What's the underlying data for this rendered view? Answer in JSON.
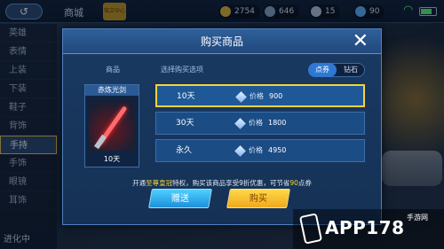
{
  "topbar": {
    "back_label": "↺",
    "title": "商城",
    "badge": "铭文中心",
    "currencies": [
      {
        "name": "gold",
        "value": "2754",
        "color": "#e4b63a"
      },
      {
        "name": "coupon",
        "value": "646",
        "color": "#8aa7c9"
      },
      {
        "name": "gem",
        "value": "15",
        "color": "#b9c9de"
      },
      {
        "name": "diamond",
        "value": "90",
        "color": "#5fb4ff"
      }
    ]
  },
  "sidebar": {
    "items": [
      "英雄",
      "表情",
      "上装",
      "下装",
      "鞋子",
      "背饰",
      "手持",
      "手饰",
      "眼镜",
      "耳饰"
    ],
    "active_index": 6,
    "footer": "进化中"
  },
  "dialog": {
    "title": "购买商品",
    "close_icon": "close-icon",
    "col_item": "商品",
    "col_options": "选择购买选项",
    "tabs": [
      "点券",
      "钻石"
    ],
    "active_tab": 0,
    "item": {
      "name": "赤炼光剑",
      "duration": "10天"
    },
    "options": [
      {
        "label": "10天",
        "price_label": "价格",
        "price": "900",
        "selected": true
      },
      {
        "label": "30天",
        "price_label": "价格",
        "price": "1800",
        "selected": false
      },
      {
        "label": "永久",
        "price_label": "价格",
        "price": "4950",
        "selected": false
      }
    ],
    "notice": {
      "prefix": "开通",
      "highlight": "至尊皇冠",
      "middle": "特权，购买该商品享受9折优惠，可节省",
      "amount": "90",
      "suffix": "点券"
    },
    "gift_button": "赠送",
    "buy_button": "购买"
  },
  "watermark": {
    "text": "APP178",
    "sub": "手游网"
  },
  "colors": {
    "accent": "#f5d33a",
    "dialog_bg": "#1a3a63",
    "tab_active": "#2e78d4"
  }
}
